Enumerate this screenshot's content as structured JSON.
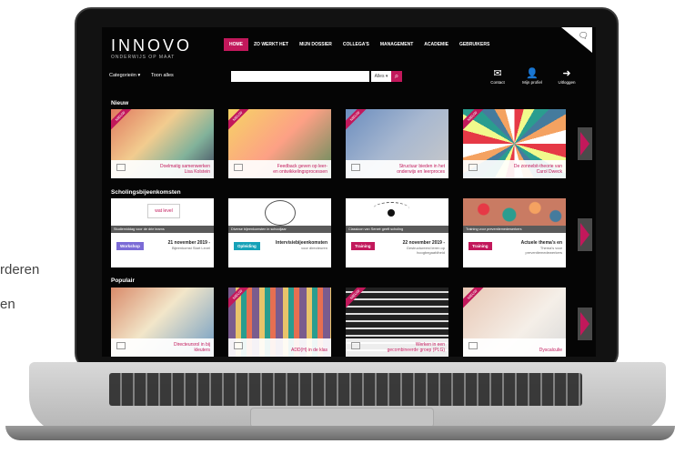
{
  "side_text": [
    "rderen",
    "en"
  ],
  "header": {
    "logo": "INNOVO",
    "tagline": "ONDERWIJS OP MAAT",
    "nav": [
      "HOME",
      "ZO WERKT HET",
      "MIJN DOSSIER",
      "COLLEGA'S",
      "MANAGEMENT",
      "ACADEMIE",
      "GEBRUIKERS"
    ]
  },
  "toolbar": {
    "categories": "Categorieën ▾",
    "show_all": "Toon alles",
    "search_placeholder": "",
    "search_select": "Alles ▾",
    "icons": [
      {
        "icon": "envelope-icon",
        "label": "Contact"
      },
      {
        "icon": "person-icon",
        "label": "Mijn profiel"
      },
      {
        "icon": "logout-icon",
        "label": "Uitloggen"
      }
    ]
  },
  "sections": {
    "nieuw": "Nieuw",
    "scholing": "Scholingsbijeenkomsten",
    "populair": "Populair"
  },
  "nieuw_tiles": [
    {
      "badge": "NIEUW",
      "title": "Doelmatig samenwerken",
      "subtitle": "Lisa Kolstein",
      "color": "#e07a5f"
    },
    {
      "badge": "NIEUW",
      "title": "Feedback geven op leer-",
      "subtitle": "en ontwikkelingsprocessen",
      "color": "#f2c14e"
    },
    {
      "badge": "NIEUW",
      "title": "Structuur bieden in het",
      "subtitle": "onderwijs en leerproces",
      "color": "#6c8ebf"
    },
    {
      "badge": "NIEUW",
      "title": "De zonnebit-theorie van",
      "subtitle": "Carol Dweck",
      "color": "#d9d9d9"
    }
  ],
  "scholing_tiles": [
    {
      "header_text": "wat level",
      "strip": "Studiemiddag voor de drie teams",
      "pill": "Workshop",
      "pill_color": "#7b6bd6",
      "date": "21 november 2019 -",
      "sub": "Bijeenkomst Start Level"
    },
    {
      "header_text": "",
      "strip": "Diverse bijeenkomsten in schooljaar",
      "pill": "Opleiding",
      "pill_color": "#17a2b8",
      "date": "Intervisiebijeenkomsten",
      "sub": "voor directeuren"
    },
    {
      "header_text": "",
      "strip": "Classicon van Seneé geeft scholing",
      "pill": "Training",
      "pill_color": "#c2185b",
      "date": "22 november 2019 -",
      "sub": "Gestructureerd leren op hoogbegaafdheid"
    },
    {
      "header_text": "",
      "strip": "Training voor preventiemedewerkers",
      "pill": "Training",
      "pill_color": "#c2185b",
      "date": "Actuele thema's en",
      "sub": "Thema's voor preventiemedewerkers"
    }
  ],
  "populair_tiles": [
    {
      "badge": "",
      "title": "Directeursrol in bij",
      "subtitle": "kleuters",
      "color": "#d98b6b"
    },
    {
      "badge": "NIEUW",
      "title": "ADD(H) in de klas",
      "subtitle": "",
      "color": "#7a5c8e"
    },
    {
      "badge": "NIEUW",
      "title": "Werken in een",
      "subtitle": "gecombineerde groep (PLG)",
      "color": "#333333"
    },
    {
      "badge": "NIEUW",
      "title": "Dyscalculie",
      "subtitle": "",
      "color": "#e8c7b4"
    }
  ]
}
